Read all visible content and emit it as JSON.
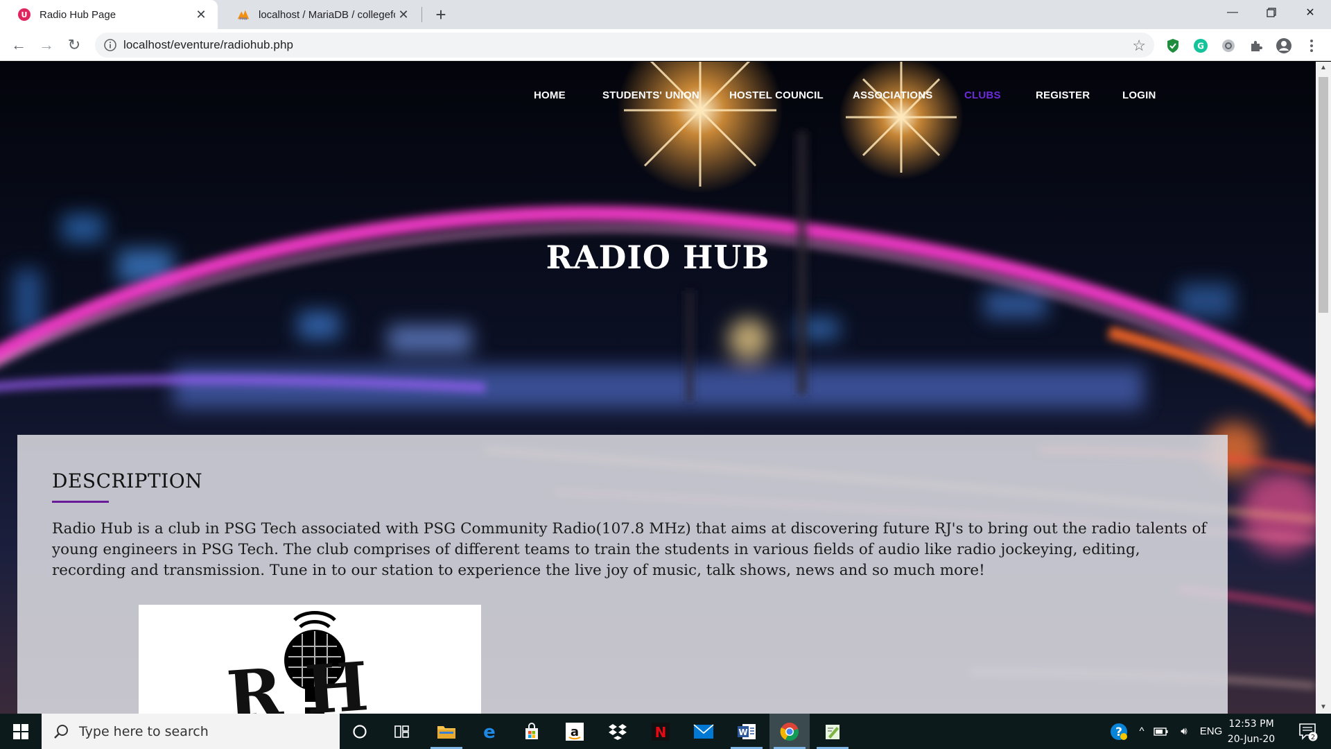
{
  "browser": {
    "tabs": [
      {
        "title": "Radio Hub Page",
        "active": true
      },
      {
        "title": "localhost / MariaDB / collegeforu",
        "active": false
      }
    ],
    "url": "localhost/eventure/radiohub.php"
  },
  "site": {
    "nav": [
      {
        "label": "HOME",
        "current": false
      },
      {
        "label": "STUDENTS' UNION",
        "current": false
      },
      {
        "label": "HOSTEL COUNCIL",
        "current": false
      },
      {
        "label": "ASSOCIATIONS",
        "current": false
      },
      {
        "label": "CLUBS",
        "current": true
      },
      {
        "label": "REGISTER",
        "current": false
      },
      {
        "label": "LOGIN",
        "current": false
      }
    ],
    "hero_title": "RADIO HUB",
    "description_heading": "DESCRIPTION",
    "description_text": "Radio Hub is a club in PSG Tech associated with PSG Community Radio(107.8 MHz) that aims at discovering future RJ's to bring out the radio talents of young engineers in PSG Tech. The club comprises of different teams to train the students in various fields of audio like radio jockeying, editing, recording and transmission. Tune in to our station to experience the live joy of music, talk shows, news and so much more!",
    "logo_text": "R H",
    "accent_color": "#6a1b9a",
    "nav_current_color": "#6c2bd9"
  },
  "taskbar": {
    "search_placeholder": "Type here to search",
    "language": "ENG",
    "time": "12:53 PM",
    "date": "20-Jun-20",
    "notification_count": "2"
  }
}
